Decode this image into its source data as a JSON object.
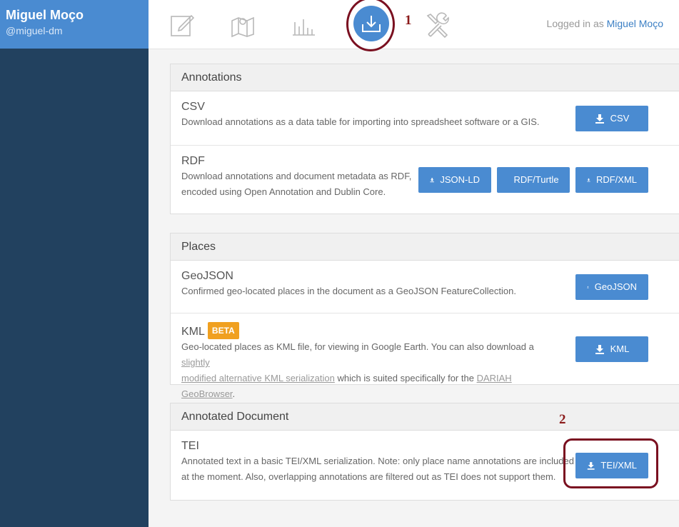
{
  "profile": {
    "name": "Miguel Moço",
    "handle": "@miguel-dm"
  },
  "topbar": {
    "login_prefix": "Logged in as",
    "login_user": "Miguel Moço"
  },
  "markers": {
    "one": "1",
    "two": "2"
  },
  "annotations": {
    "heading": "Annotations",
    "csv": {
      "title": "CSV",
      "desc": "Download annotations as a data table for importing into spreadsheet software or a GIS.",
      "button": "CSV"
    },
    "rdf": {
      "title": "RDF",
      "desc_line1": "Download annotations and document metadata as RDF,",
      "desc_line2": "encoded using Open Annotation and Dublin Core.",
      "buttons": [
        "JSON-LD",
        "RDF/Turtle",
        "RDF/XML"
      ]
    }
  },
  "places": {
    "heading": "Places",
    "geojson": {
      "title": "GeoJSON",
      "desc": "Confirmed geo-located places in the document as a GeoJSON FeatureCollection.",
      "button": "GeoJSON"
    },
    "kml": {
      "title": "KML",
      "badge": "BETA",
      "desc_part1": "Geo-located places as KML file, for viewing in Google Earth. You can also download a",
      "link1_line1": "slightly",
      "link1_line2": "modified alternative KML serialization",
      "desc_part2": "which is suited specifically for the",
      "link2": "DARIAH GeoBrowser",
      "desc_end": ".",
      "button": "KML"
    }
  },
  "annotated_document": {
    "heading": "Annotated Document",
    "tei": {
      "title": "TEI",
      "desc_line1": "Annotated text in a basic TEI/XML serialization. Note: only place name annotations are included",
      "desc_line2": "at the moment. Also, overlapping annotations are filtered out as TEI does not support them.",
      "button": "TEI/XML"
    }
  },
  "colors": {
    "accent": "#4a8bd1",
    "sidebar": "#22415f",
    "badge": "#f0a020",
    "marker": "#7a1020"
  }
}
